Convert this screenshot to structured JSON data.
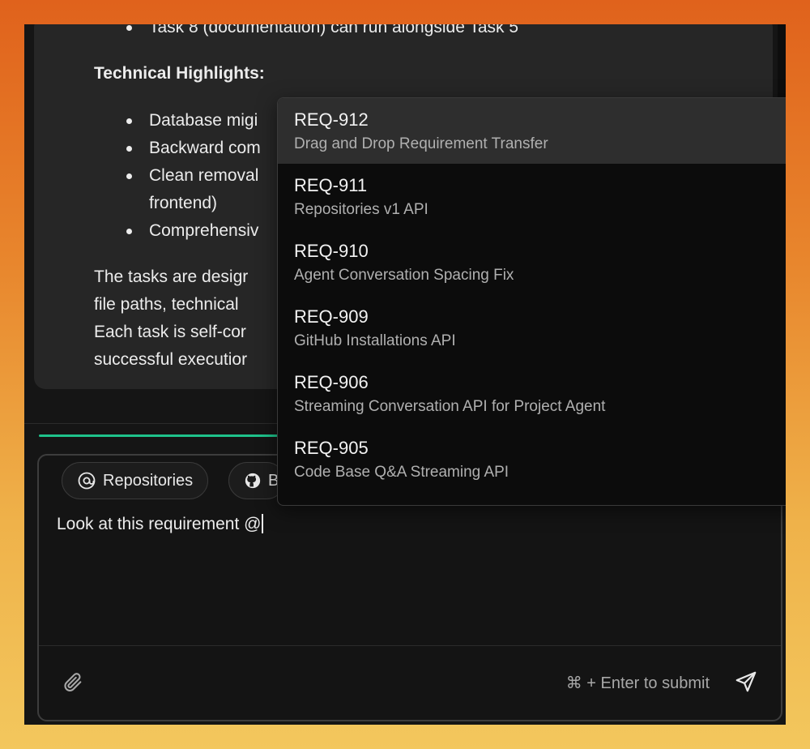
{
  "chat": {
    "line_task8": "Task 8 (documentation) can run alongside Task 5",
    "heading": "Technical Highlights:",
    "bullets": [
      "Database migi",
      "Backward com",
      "Clean removal",
      "Comprehensiv"
    ],
    "bullet3_cont": "frontend)",
    "para": [
      "The tasks are desigr",
      "file paths, technical",
      "Each task is self-cor",
      "successful executior"
    ]
  },
  "composer": {
    "chips": [
      {
        "icon": "at-icon",
        "label": "Repositories"
      },
      {
        "icon": "github-icon",
        "label": "B"
      }
    ],
    "input_value": "Look at this requirement @",
    "submit_hint": "⌘ + Enter to submit"
  },
  "dropdown": {
    "items": [
      {
        "id": "REQ-912",
        "title": "Drag and Drop Requirement Transfer",
        "active": true
      },
      {
        "id": "REQ-911",
        "title": "Repositories v1 API",
        "active": false
      },
      {
        "id": "REQ-910",
        "title": "Agent Conversation Spacing Fix",
        "active": false
      },
      {
        "id": "REQ-909",
        "title": "GitHub Installations API",
        "active": false
      },
      {
        "id": "REQ-906",
        "title": "Streaming Conversation API for Project Agent",
        "active": false
      },
      {
        "id": "REQ-905",
        "title": "Code Base Q&A Streaming API",
        "active": false
      }
    ]
  },
  "colors": {
    "accent_progress": "#1ec28b",
    "background_top": "#e0621c",
    "background_bottom": "#f3c75d"
  }
}
